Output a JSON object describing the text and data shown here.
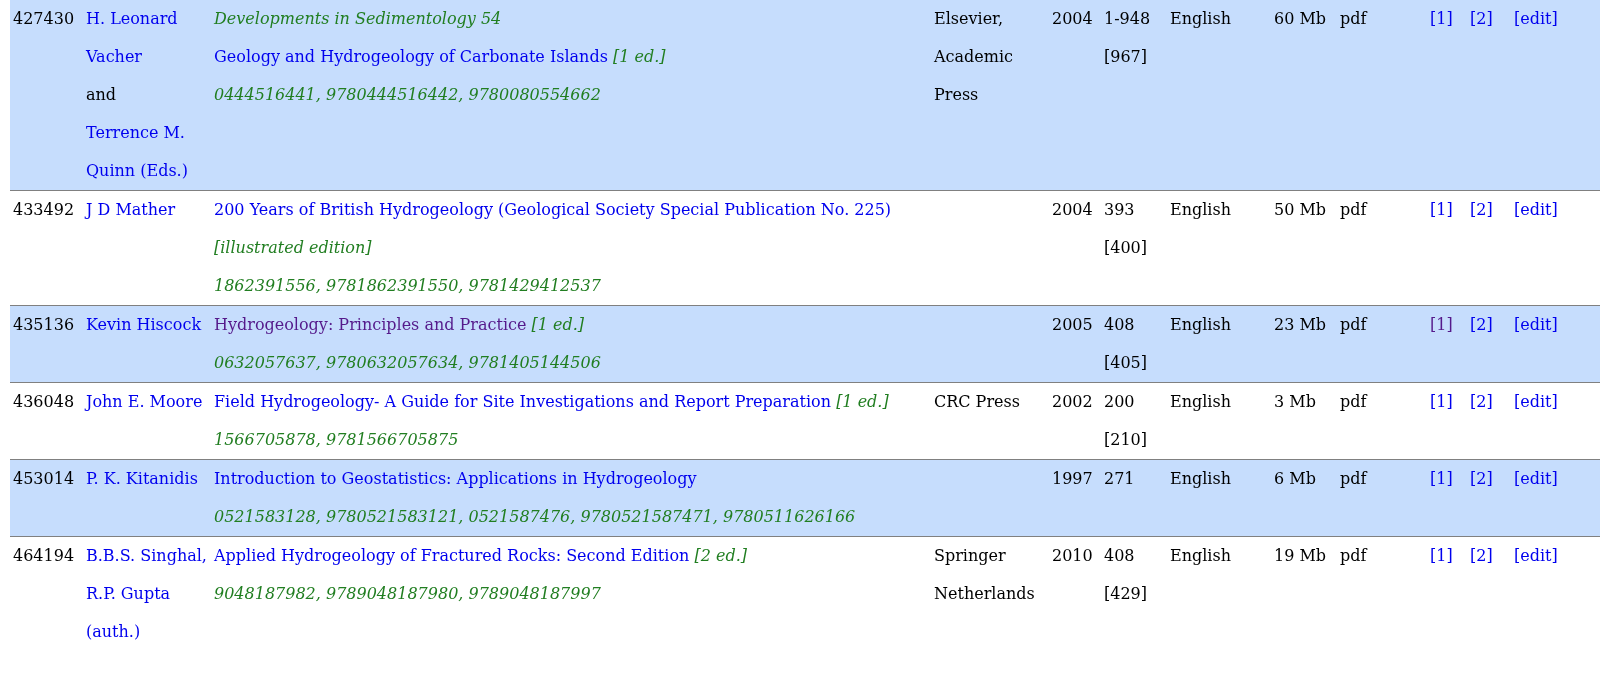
{
  "rows": [
    {
      "id": "427430",
      "authors": [
        {
          "text": "H. Leonard Vacher",
          "kind": "link"
        },
        {
          "text": "and",
          "kind": "plain"
        },
        {
          "text": "Terrence M. Quinn (Eds.)",
          "kind": "link"
        }
      ],
      "series": "Developments in Sedimentology 54",
      "title": "Geology and Hydrogeology of Carbonate Islands",
      "title_visited": false,
      "edition": "[1 ed.]",
      "isbn": "0444516441, 9780444516442, 9780080554662",
      "publisher": "Elsevier, Academic Press",
      "year": "2004",
      "pages": "1-948",
      "pages_total": "[967]",
      "language": "English",
      "size": "60 Mb",
      "extension": "pdf",
      "mirrors": [
        {
          "label": "[1]",
          "visited": false
        },
        {
          "label": "[2]",
          "visited": false
        },
        {
          "label": "[edit]",
          "visited": false
        }
      ]
    },
    {
      "id": "433492",
      "authors": [
        {
          "text": "J D Mather",
          "kind": "link"
        }
      ],
      "title": "200 Years of British Hydrogeology (Geological Society Special Publication No. 225)",
      "title_visited": false,
      "edition": "[illustrated edition]",
      "isbn": "1862391556, 9781862391550, 9781429412537",
      "year": "2004",
      "pages": "393",
      "pages_total": "[400]",
      "language": "English",
      "size": "50 Mb",
      "extension": "pdf",
      "mirrors": [
        {
          "label": "[1]",
          "visited": false
        },
        {
          "label": "[2]",
          "visited": false
        },
        {
          "label": "[edit]",
          "visited": false
        }
      ]
    },
    {
      "id": "435136",
      "authors": [
        {
          "text": "Kevin Hiscock",
          "kind": "link"
        }
      ],
      "title": "Hydrogeology: Principles and Practice",
      "title_visited": true,
      "edition": "[1 ed.]",
      "isbn": "0632057637, 9780632057634, 9781405144506",
      "year": "2005",
      "pages": "408",
      "pages_total": "[405]",
      "language": "English",
      "size": "23 Mb",
      "extension": "pdf",
      "mirrors": [
        {
          "label": "[1]",
          "visited": true
        },
        {
          "label": "[2]",
          "visited": false
        },
        {
          "label": "[edit]",
          "visited": false
        }
      ]
    },
    {
      "id": "436048",
      "authors": [
        {
          "text": "John E. Moore",
          "kind": "link"
        }
      ],
      "title": "Field Hydrogeology- A Guide for Site Investigations and Report Preparation",
      "title_visited": false,
      "edition": "[1 ed.]",
      "isbn": "1566705878, 9781566705875",
      "publisher": "CRC Press",
      "year": "2002",
      "pages": "200",
      "pages_total": "[210]",
      "language": "English",
      "size": "3 Mb",
      "extension": "pdf",
      "mirrors": [
        {
          "label": "[1]",
          "visited": false
        },
        {
          "label": "[2]",
          "visited": false
        },
        {
          "label": "[edit]",
          "visited": false
        }
      ]
    },
    {
      "id": "453014",
      "authors": [
        {
          "text": "P. K. Kitanidis",
          "kind": "link"
        }
      ],
      "title": "Introduction to Geostatistics: Applications in Hydrogeology",
      "title_visited": false,
      "isbn": "0521583128, 9780521583121, 0521587476, 9780521587471, 9780511626166",
      "year": "1997",
      "pages": "271",
      "language": "English",
      "size": "6 Mb",
      "extension": "pdf",
      "mirrors": [
        {
          "label": "[1]",
          "visited": false
        },
        {
          "label": "[2]",
          "visited": false
        },
        {
          "label": "[edit]",
          "visited": false
        }
      ]
    },
    {
      "id": "464194",
      "authors": [
        {
          "text": "B.B.S. Singhal, R.P. Gupta (auth.)",
          "kind": "link"
        }
      ],
      "title": "Applied Hydrogeology of Fractured Rocks: Second Edition",
      "title_visited": false,
      "edition": "[2 ed.]",
      "isbn": "9048187982, 9789048187980, 9789048187997",
      "publisher": "Springer Netherlands",
      "year": "2010",
      "pages": "408",
      "pages_total": "[429]",
      "language": "English",
      "size": "19 Mb",
      "extension": "pdf",
      "mirrors": [
        {
          "label": "[1]",
          "visited": false
        },
        {
          "label": "[2]",
          "visited": false
        },
        {
          "label": "[edit]",
          "visited": false
        }
      ]
    }
  ]
}
